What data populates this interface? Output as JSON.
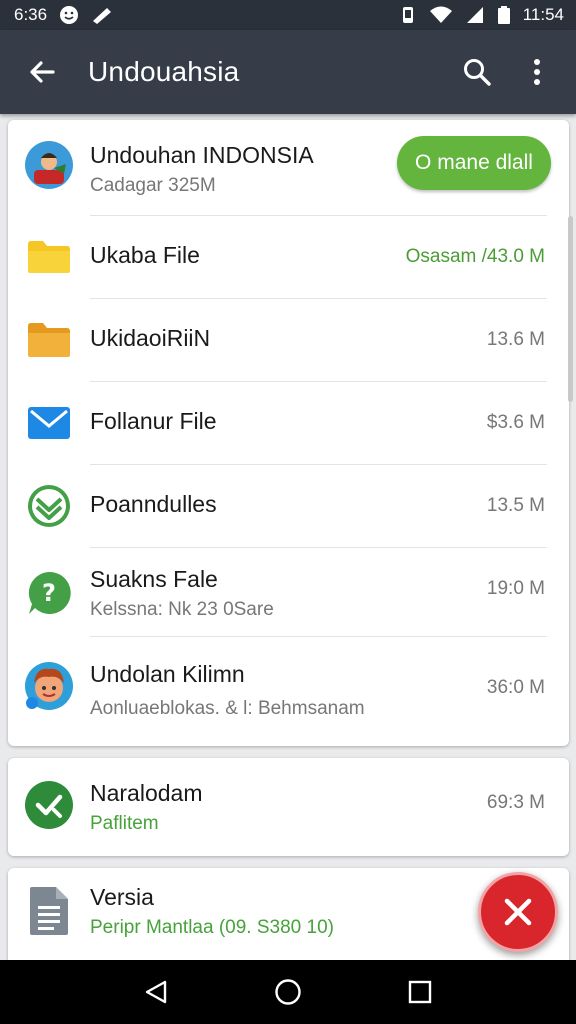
{
  "status_bar": {
    "time_left": "6:36",
    "time_right": "11:54",
    "icons": [
      "smiley-icon",
      "pen-icon",
      "vibrate-icon",
      "wifi-icon",
      "signal-icon",
      "battery-icon"
    ]
  },
  "app_bar": {
    "title": "Undouahsia",
    "icons": [
      "back-arrow-icon",
      "search-icon",
      "more-vert-icon"
    ]
  },
  "header_item": {
    "title": "Undouhan INDONSIA",
    "subtitle": "Cadagar 325M",
    "button_label": "O mane dlall",
    "accent": "#63b53d"
  },
  "items": [
    {
      "name": "Ukaba File",
      "size": "Osasam /43.0 M",
      "icon": "folder-yellow-icon",
      "highlight": true
    },
    {
      "name": "UkidaoiRiiN",
      "size": "13.6 M",
      "icon": "folder-orange-icon"
    },
    {
      "name": "Follanur File",
      "size": "$3.6 M",
      "icon": "mail-icon"
    },
    {
      "name": "Poanndulles",
      "size": "13.5 M",
      "icon": "chevron-down-badge-icon"
    },
    {
      "name": "Suakns Fale",
      "subtitle": "Kelssna: Nk 23 0Sare",
      "size": "19:0 M",
      "icon": "chat-question-icon"
    },
    {
      "name": "Undolan Kilimn",
      "subtitle": "Aonluaeblokas. & l: Behmsanam",
      "size": "36:0 M",
      "icon": "avatar-icon"
    }
  ],
  "card2": {
    "name": "Naralodam",
    "subtitle": "Paflitem",
    "size": "69:3 M",
    "icon": "check-circle-icon"
  },
  "card3": {
    "name": "Versia",
    "subtitle": "Peripr Mantlaa (09. S380 10)",
    "icon": "document-icon"
  },
  "fab": {
    "icon": "close-icon",
    "color": "#d9262c"
  },
  "nav_bar": {
    "icons": [
      "nav-back-icon",
      "nav-home-icon",
      "nav-recents-icon"
    ]
  }
}
